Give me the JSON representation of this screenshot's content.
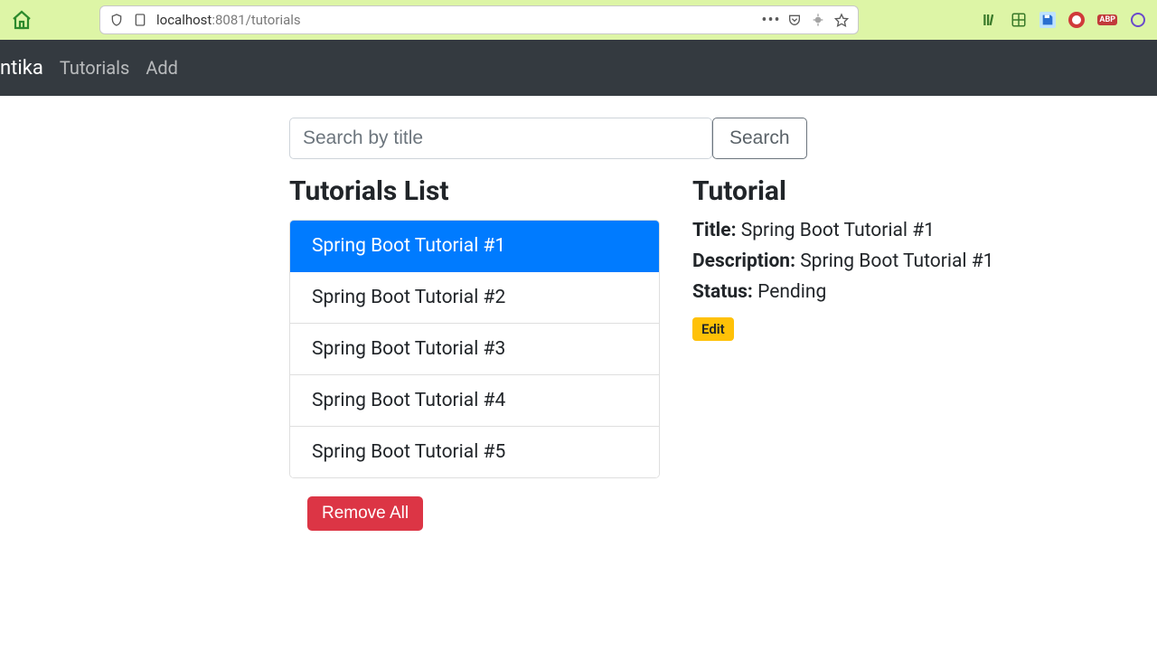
{
  "browser": {
    "url_prefix": "localhost",
    "url_suffix": ":8081/tutorials"
  },
  "navbar": {
    "brand": "ntika",
    "links": [
      "Tutorials",
      "Add"
    ]
  },
  "search": {
    "placeholder": "Search by title",
    "button": "Search"
  },
  "list": {
    "heading": "Tutorials List",
    "items": [
      "Spring Boot Tutorial #1",
      "Spring Boot Tutorial #2",
      "Spring Boot Tutorial #3",
      "Spring Boot Tutorial #4",
      "Spring Boot Tutorial #5"
    ],
    "active_index": 0,
    "remove_all": "Remove All"
  },
  "detail": {
    "heading": "Tutorial",
    "title_label": "Title:",
    "title_value": "Spring Boot Tutorial #1",
    "description_label": "Description:",
    "description_value": "Spring Boot Tutorial #1",
    "status_label": "Status:",
    "status_value": "Pending",
    "edit": "Edit"
  }
}
